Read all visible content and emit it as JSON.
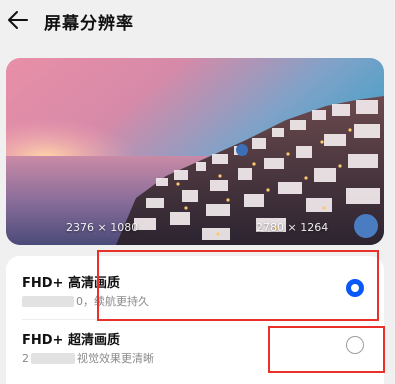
{
  "header": {
    "back_icon": "arrow-left-icon",
    "title": "屏幕分辨率"
  },
  "preview": {
    "left_resolution": "2376 × 1080",
    "right_resolution": "2780 × 1264"
  },
  "options": [
    {
      "title": "FHD+ 高清画质",
      "subtitle_visible": "0，续航更持久",
      "selected": true
    },
    {
      "title": "FHD+ 超清画质",
      "subtitle_prefix": "2",
      "subtitle_visible": "视觉效果更清晰",
      "selected": false
    }
  ],
  "colors": {
    "accent": "#0a59f7",
    "annotation": "#e8312a"
  }
}
